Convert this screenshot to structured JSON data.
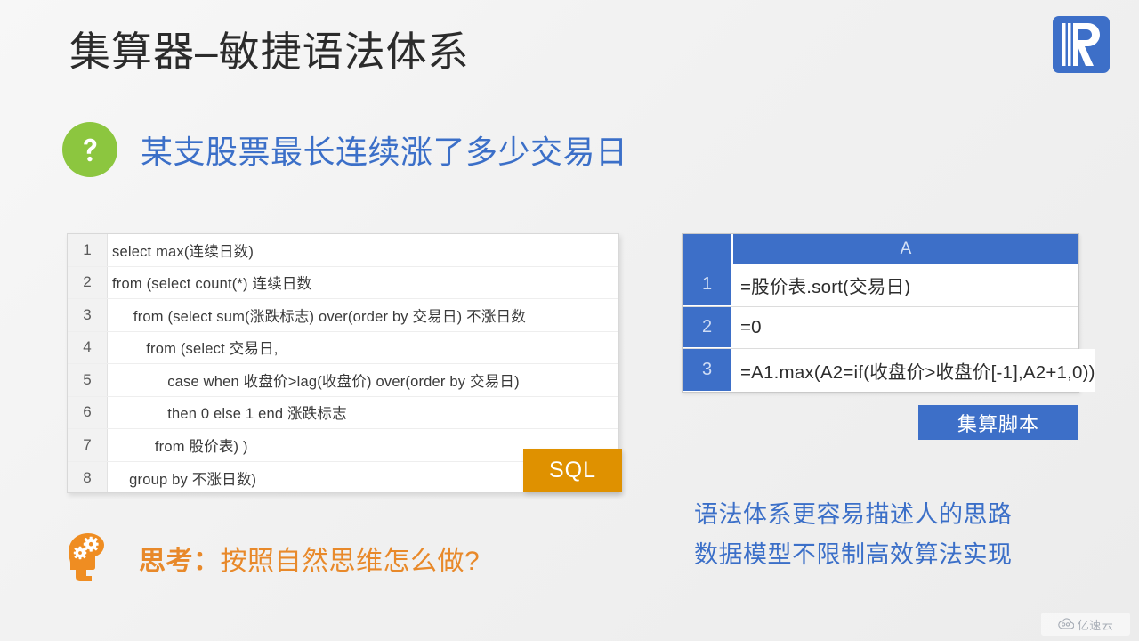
{
  "slide": {
    "title": "集算器–敏捷语法体系",
    "background_color": "#f2f2f2"
  },
  "logo": {
    "name": "raqsoft-logo",
    "letter": "R",
    "color": "#3d6fc8"
  },
  "question": {
    "badge_icon": "question-mark-icon",
    "badge_color": "#8cc63f",
    "text": "某支股票最长连续涨了多少交易日",
    "text_color": "#3b6fc8"
  },
  "sql_panel": {
    "tag_label": "SQL",
    "tag_color": "#df9100",
    "lines": [
      {
        "no": "1",
        "code": "select max(连续日数)"
      },
      {
        "no": "2",
        "code": "from (select count(*) 连续日数"
      },
      {
        "no": "3",
        "code": "     from (select sum(涨跌标志) over(order by 交易日) 不涨日数"
      },
      {
        "no": "4",
        "code": "        from (select 交易日,"
      },
      {
        "no": "5",
        "code": "             case when 收盘价>lag(收盘价) over(order by 交易日)"
      },
      {
        "no": "6",
        "code": "             then 0 else 1 end 涨跌标志"
      },
      {
        "no": "7",
        "code": "          from 股价表) )"
      },
      {
        "no": "8",
        "code": "    group by 不涨日数)"
      }
    ]
  },
  "spl_panel": {
    "column_header": "A",
    "header_color": "#3d6fc8",
    "rows": [
      {
        "no": "1",
        "cell": "=股价表.sort(交易日)"
      },
      {
        "no": "2",
        "cell": "=0"
      },
      {
        "no": "3",
        "cell": "=A1.max(A2=if(收盘价>收盘价[-1],A2+1,0))"
      }
    ],
    "tag_label": "集算脚本",
    "tag_color": "#3d6fc8"
  },
  "takeaways": [
    "语法体系更容易描述人的思路",
    "数据模型不限制高效算法实现"
  ],
  "think": {
    "icon": "head-gears-icon",
    "icon_color": "#ef8d22",
    "lead": "思考：",
    "text": "按照自然思维怎么做?",
    "text_color": "#e8892a"
  },
  "watermark": {
    "icon": "cloud-icon",
    "text": "亿速云"
  }
}
